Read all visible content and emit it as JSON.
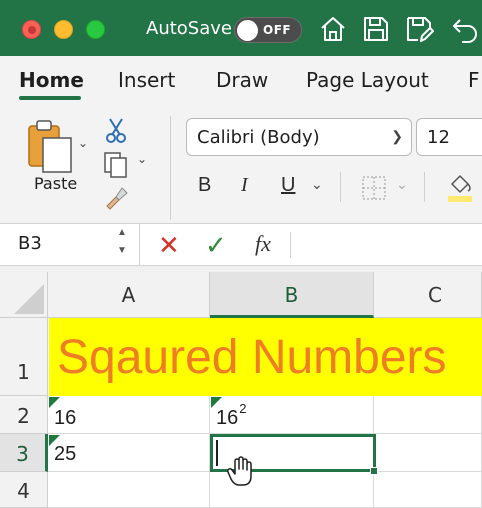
{
  "titlebar": {
    "autosave_label": "AutoSave",
    "autosave_state": "OFF",
    "icons": [
      "home-icon",
      "save-icon",
      "save-as-icon",
      "undo-icon"
    ],
    "colors": {
      "accent": "#227447"
    }
  },
  "ribbon": {
    "tabs": [
      {
        "label": "Home",
        "active": true
      },
      {
        "label": "Insert"
      },
      {
        "label": "Draw"
      },
      {
        "label": "Page Layout"
      },
      {
        "label": "F"
      }
    ],
    "paste_label": "Paste",
    "font_name": "Calibri (Body)",
    "font_size": "12",
    "bold_label": "B",
    "italic_label": "I",
    "underline_label": "U"
  },
  "formula_bar": {
    "name_box": "B3",
    "fx_label": "fx",
    "content": ""
  },
  "sheet": {
    "columns": [
      "A",
      "B",
      "C"
    ],
    "rows": [
      "1",
      "2",
      "3",
      "4"
    ],
    "selected_column": "B",
    "selected_row": "3",
    "title": "Sqaured Numbers",
    "a2": "16",
    "b2_base": "16",
    "b2_exp": "2",
    "a3": "25",
    "b3": "",
    "title_color": "#ef7d25",
    "title_fill": "#ffff00"
  }
}
